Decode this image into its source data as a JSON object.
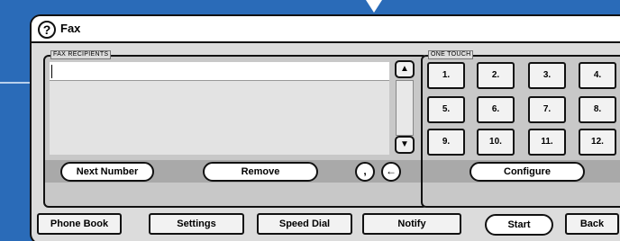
{
  "window": {
    "title": "Fax",
    "help_icon": "?"
  },
  "recipients": {
    "label": "FAX RECIPIENTS",
    "input_value": "",
    "next_number_label": "Next Number",
    "remove_label": "Remove",
    "comma_label": ",",
    "backspace_icon": "←",
    "scroll_up_icon": "▲",
    "scroll_down_icon": "▼"
  },
  "one_touch": {
    "label": "ONE TOUCH",
    "keys": [
      "1.",
      "2.",
      "3.",
      "4.",
      "5.",
      "6.",
      "7.",
      "8.",
      "9.",
      "10.",
      "11.",
      "12."
    ],
    "configure_label": "Configure"
  },
  "toolbar": {
    "phone_book": "Phone Book",
    "settings": "Settings",
    "speed_dial": "Speed Dial",
    "notify": "Notify",
    "start": "Start",
    "back": "Back"
  }
}
